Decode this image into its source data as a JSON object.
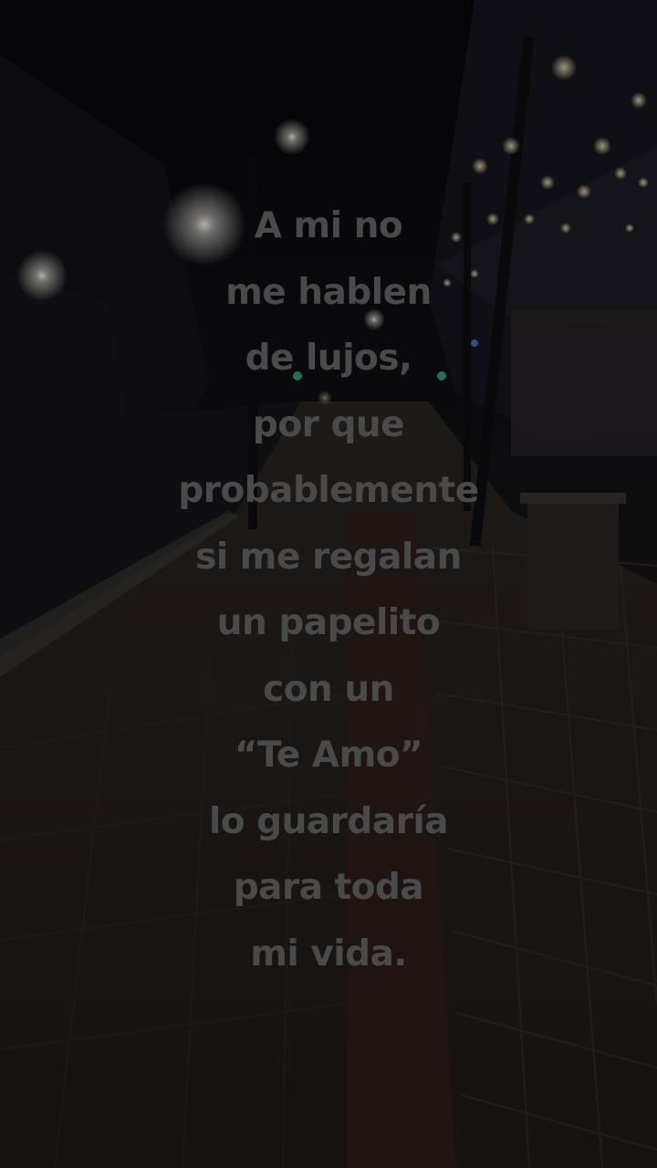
{
  "caption": {
    "lines": [
      "A mi no",
      "me hablen",
      "de lujos,",
      "por que",
      "probablemente",
      "si me regalan",
      "un papelito",
      "con un",
      "“Te Amo”",
      "lo guardaría",
      "para toda",
      "mi vida."
    ]
  },
  "colors": {
    "caption_text": "#4a4a4a",
    "sky": "#07070c",
    "sidewalk": "#221c18",
    "street_light": "#f4f2e6",
    "bokeh": "#f2e2b8"
  }
}
